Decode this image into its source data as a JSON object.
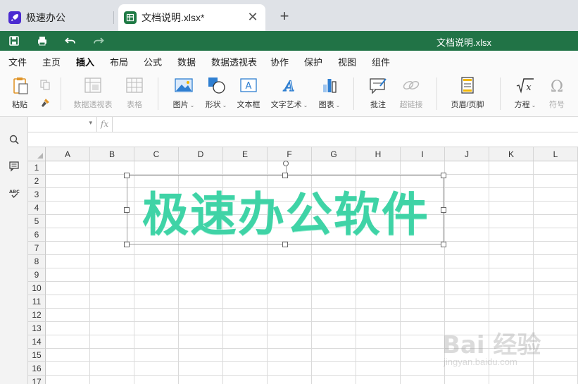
{
  "tabs": {
    "app_label": "极速办公",
    "doc_label": "文档说明.xlsx*",
    "close_glyph": "✕",
    "new_tab_glyph": "+"
  },
  "titlebar": {
    "title": "文档说明.xlsx",
    "color": "#217346"
  },
  "menu": [
    {
      "label": "文件",
      "active": false
    },
    {
      "label": "主页",
      "active": false
    },
    {
      "label": "插入",
      "active": true
    },
    {
      "label": "布局",
      "active": false
    },
    {
      "label": "公式",
      "active": false
    },
    {
      "label": "数据",
      "active": false
    },
    {
      "label": "数据透视表",
      "active": false
    },
    {
      "label": "协作",
      "active": false
    },
    {
      "label": "保护",
      "active": false
    },
    {
      "label": "视图",
      "active": false
    },
    {
      "label": "组件",
      "active": false
    }
  ],
  "ribbon": {
    "paste": "粘贴",
    "pivot": "数据透视表",
    "table": "表格",
    "image": "图片",
    "shape": "形状",
    "textbox": "文本框",
    "wordart": "文字艺术",
    "chart": "图表",
    "comment": "批注",
    "hyperlink": "超链接",
    "header_footer": "页眉/页脚",
    "equation": "方程",
    "symbol": "符号"
  },
  "formula": {
    "fx": "fx",
    "namebox_value": "",
    "formula_value": ""
  },
  "columns": [
    "A",
    "B",
    "C",
    "D",
    "E",
    "F",
    "G",
    "H",
    "I",
    "J",
    "K",
    "L"
  ],
  "rows": [
    "1",
    "2",
    "3",
    "4",
    "5",
    "6",
    "7",
    "8",
    "9",
    "10",
    "11",
    "12",
    "13",
    "14",
    "15",
    "16",
    "17"
  ],
  "wordart_text": "极速办公软件",
  "watermark": {
    "brand": "Bai 经验",
    "url": "jingyan.baidu.com"
  }
}
